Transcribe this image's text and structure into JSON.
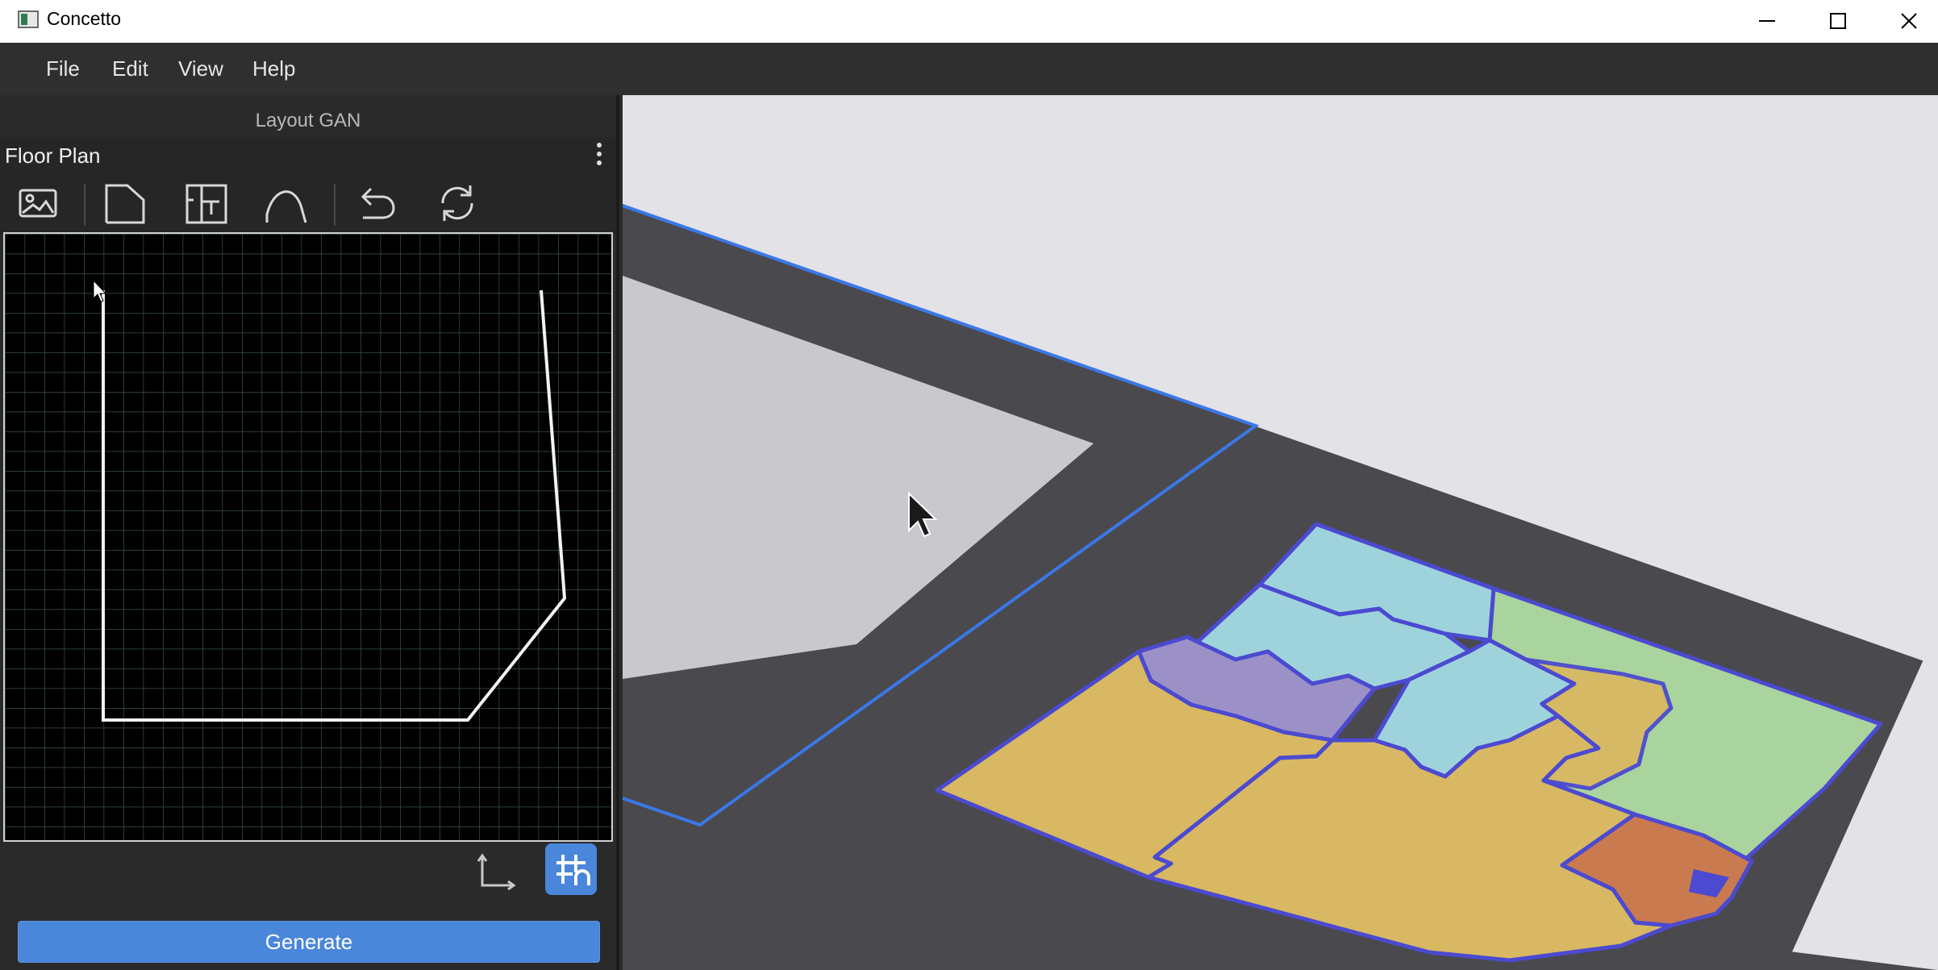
{
  "window": {
    "title": "Concetto",
    "minimize_icon": "minimize-icon",
    "maximize_icon": "maximize-icon",
    "close_icon": "close-icon"
  },
  "menu": {
    "items": [
      {
        "label": "File"
      },
      {
        "label": "Edit"
      },
      {
        "label": "View"
      },
      {
        "label": "Help"
      }
    ]
  },
  "left_panel": {
    "title": "Layout GAN",
    "section_label": "Floor Plan",
    "toolbar": [
      {
        "icon": "image-icon"
      },
      {
        "icon": "polygon-icon"
      },
      {
        "icon": "floor-plan-icon"
      },
      {
        "icon": "curve-icon"
      },
      {
        "icon": "undo-icon"
      },
      {
        "icon": "refresh-icon"
      }
    ],
    "axis_toggle_icon": "axis-icon",
    "grid_snap_icon": "grid-snap-icon",
    "generate_label": "Generate"
  },
  "colors": {
    "accent": "#4a86d9",
    "room_teal": "#9fd3dc",
    "room_green": "#a9d49d",
    "room_yellow": "#d8b863",
    "room_purple": "#9c91c7",
    "room_orange": "#c97a4e",
    "outline": "#4b4ad0",
    "ground_dark": "#4a494e",
    "floor_light": "#c9c8cc"
  }
}
